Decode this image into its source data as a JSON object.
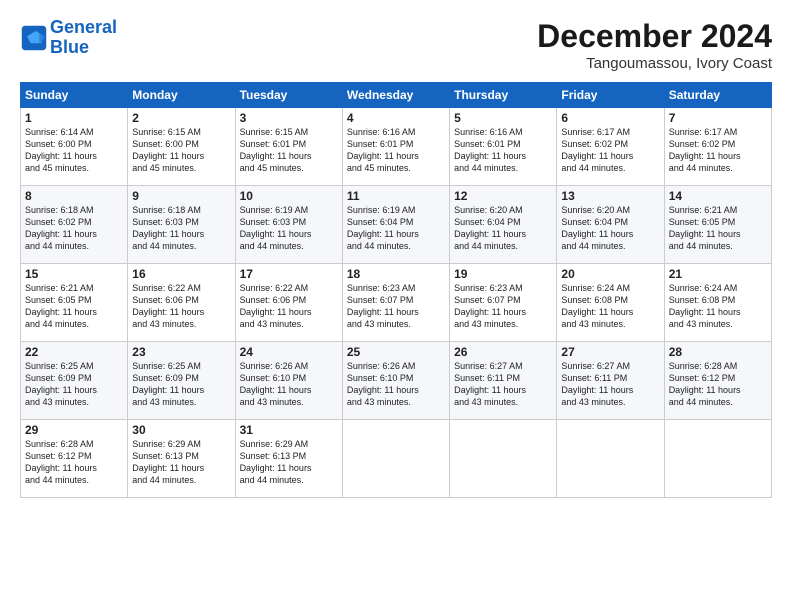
{
  "header": {
    "logo_line1": "General",
    "logo_line2": "Blue",
    "month": "December 2024",
    "location": "Tangoumassou, Ivory Coast"
  },
  "days_of_week": [
    "Sunday",
    "Monday",
    "Tuesday",
    "Wednesday",
    "Thursday",
    "Friday",
    "Saturday"
  ],
  "weeks": [
    [
      {
        "day": "1",
        "text": "Sunrise: 6:14 AM\nSunset: 6:00 PM\nDaylight: 11 hours\nand 45 minutes."
      },
      {
        "day": "2",
        "text": "Sunrise: 6:15 AM\nSunset: 6:00 PM\nDaylight: 11 hours\nand 45 minutes."
      },
      {
        "day": "3",
        "text": "Sunrise: 6:15 AM\nSunset: 6:01 PM\nDaylight: 11 hours\nand 45 minutes."
      },
      {
        "day": "4",
        "text": "Sunrise: 6:16 AM\nSunset: 6:01 PM\nDaylight: 11 hours\nand 45 minutes."
      },
      {
        "day": "5",
        "text": "Sunrise: 6:16 AM\nSunset: 6:01 PM\nDaylight: 11 hours\nand 44 minutes."
      },
      {
        "day": "6",
        "text": "Sunrise: 6:17 AM\nSunset: 6:02 PM\nDaylight: 11 hours\nand 44 minutes."
      },
      {
        "day": "7",
        "text": "Sunrise: 6:17 AM\nSunset: 6:02 PM\nDaylight: 11 hours\nand 44 minutes."
      }
    ],
    [
      {
        "day": "8",
        "text": "Sunrise: 6:18 AM\nSunset: 6:02 PM\nDaylight: 11 hours\nand 44 minutes."
      },
      {
        "day": "9",
        "text": "Sunrise: 6:18 AM\nSunset: 6:03 PM\nDaylight: 11 hours\nand 44 minutes."
      },
      {
        "day": "10",
        "text": "Sunrise: 6:19 AM\nSunset: 6:03 PM\nDaylight: 11 hours\nand 44 minutes."
      },
      {
        "day": "11",
        "text": "Sunrise: 6:19 AM\nSunset: 6:04 PM\nDaylight: 11 hours\nand 44 minutes."
      },
      {
        "day": "12",
        "text": "Sunrise: 6:20 AM\nSunset: 6:04 PM\nDaylight: 11 hours\nand 44 minutes."
      },
      {
        "day": "13",
        "text": "Sunrise: 6:20 AM\nSunset: 6:04 PM\nDaylight: 11 hours\nand 44 minutes."
      },
      {
        "day": "14",
        "text": "Sunrise: 6:21 AM\nSunset: 6:05 PM\nDaylight: 11 hours\nand 44 minutes."
      }
    ],
    [
      {
        "day": "15",
        "text": "Sunrise: 6:21 AM\nSunset: 6:05 PM\nDaylight: 11 hours\nand 44 minutes."
      },
      {
        "day": "16",
        "text": "Sunrise: 6:22 AM\nSunset: 6:06 PM\nDaylight: 11 hours\nand 43 minutes."
      },
      {
        "day": "17",
        "text": "Sunrise: 6:22 AM\nSunset: 6:06 PM\nDaylight: 11 hours\nand 43 minutes."
      },
      {
        "day": "18",
        "text": "Sunrise: 6:23 AM\nSunset: 6:07 PM\nDaylight: 11 hours\nand 43 minutes."
      },
      {
        "day": "19",
        "text": "Sunrise: 6:23 AM\nSunset: 6:07 PM\nDaylight: 11 hours\nand 43 minutes."
      },
      {
        "day": "20",
        "text": "Sunrise: 6:24 AM\nSunset: 6:08 PM\nDaylight: 11 hours\nand 43 minutes."
      },
      {
        "day": "21",
        "text": "Sunrise: 6:24 AM\nSunset: 6:08 PM\nDaylight: 11 hours\nand 43 minutes."
      }
    ],
    [
      {
        "day": "22",
        "text": "Sunrise: 6:25 AM\nSunset: 6:09 PM\nDaylight: 11 hours\nand 43 minutes."
      },
      {
        "day": "23",
        "text": "Sunrise: 6:25 AM\nSunset: 6:09 PM\nDaylight: 11 hours\nand 43 minutes."
      },
      {
        "day": "24",
        "text": "Sunrise: 6:26 AM\nSunset: 6:10 PM\nDaylight: 11 hours\nand 43 minutes."
      },
      {
        "day": "25",
        "text": "Sunrise: 6:26 AM\nSunset: 6:10 PM\nDaylight: 11 hours\nand 43 minutes."
      },
      {
        "day": "26",
        "text": "Sunrise: 6:27 AM\nSunset: 6:11 PM\nDaylight: 11 hours\nand 43 minutes."
      },
      {
        "day": "27",
        "text": "Sunrise: 6:27 AM\nSunset: 6:11 PM\nDaylight: 11 hours\nand 43 minutes."
      },
      {
        "day": "28",
        "text": "Sunrise: 6:28 AM\nSunset: 6:12 PM\nDaylight: 11 hours\nand 44 minutes."
      }
    ],
    [
      {
        "day": "29",
        "text": "Sunrise: 6:28 AM\nSunset: 6:12 PM\nDaylight: 11 hours\nand 44 minutes."
      },
      {
        "day": "30",
        "text": "Sunrise: 6:29 AM\nSunset: 6:13 PM\nDaylight: 11 hours\nand 44 minutes."
      },
      {
        "day": "31",
        "text": "Sunrise: 6:29 AM\nSunset: 6:13 PM\nDaylight: 11 hours\nand 44 minutes."
      },
      {
        "day": "",
        "text": ""
      },
      {
        "day": "",
        "text": ""
      },
      {
        "day": "",
        "text": ""
      },
      {
        "day": "",
        "text": ""
      }
    ]
  ]
}
